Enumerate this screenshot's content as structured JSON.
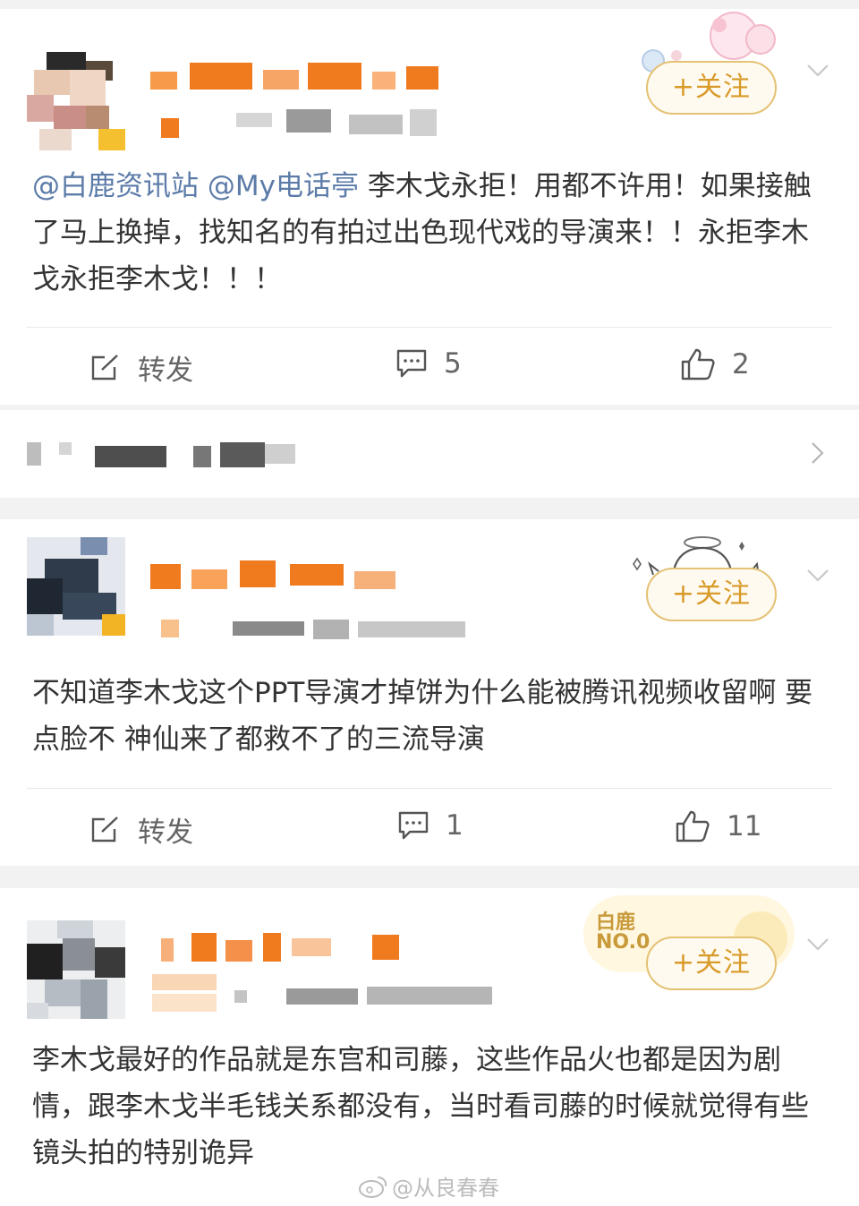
{
  "follow_label": "+关注",
  "actions": {
    "repost_label": "转发"
  },
  "posts": [
    {
      "mentions": [
        "@白鹿资讯站",
        "@My电话亭"
      ],
      "text": "李木戈永拒！用都不许用！如果接触了马上换掉，找知名的有拍过出色现代戏的导演来！！永拒李木戈永拒李木戈！！！",
      "comments": "5",
      "likes": "2"
    },
    {
      "text": "不知道李木戈这个PPT导演才掉饼为什么能被腾讯视频收留啊 要点脸不 神仙来了都救不了的三流导演",
      "comments": "1",
      "likes": "11"
    },
    {
      "badge_line1": "白鹿",
      "badge_line2": "NO.0",
      "text": "李木戈最好的作品就是东宫和司藤，这些作品火也都是因为剧情，跟李木戈半毛钱关系都没有，当时看司藤的时候就觉得有些镜头拍的特别诡异"
    }
  ],
  "watermark": "@从良春春",
  "colors": {
    "follow_border": "#e4c173",
    "follow_text": "#d89a28",
    "mention": "#5b7ba8",
    "blur_orange": "#f07a1e"
  },
  "icons": [
    "repost-icon",
    "comment-icon",
    "like-icon",
    "chevron-down-icon",
    "chevron-right-icon",
    "weibo-logo-icon"
  ]
}
